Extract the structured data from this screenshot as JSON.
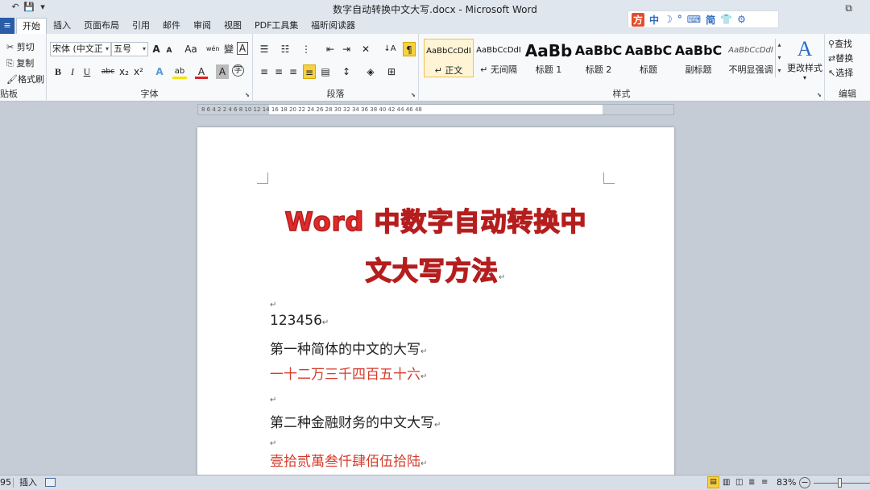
{
  "window": {
    "title": "数字自动转换中文大写.docx - Microsoft Word",
    "restore_symbol": "⧉"
  },
  "qat": {
    "save": "💾",
    "undo": "↶",
    "redo": "↷",
    "more": "▾"
  },
  "tabs": {
    "file": "≡",
    "items": [
      "开始",
      "插入",
      "页面布局",
      "引用",
      "邮件",
      "审阅",
      "视图",
      "PDF工具集",
      "福昕阅读器"
    ]
  },
  "topright_icons": [
    "方",
    "中",
    "☽",
    "°",
    "⌨",
    "简",
    "👕",
    "⚙"
  ],
  "clipboard": {
    "cut": "剪切",
    "copy": "复制",
    "painter": "格式刷",
    "label": "贴板"
  },
  "font": {
    "name": "宋体 (中文正",
    "size": "五号",
    "grow": "A",
    "shrink": "A",
    "case": "Aa",
    "phonetic": "wén",
    "encircle": "變",
    "border": "A",
    "bold": "B",
    "italic": "I",
    "underline": "U",
    "strike": "abc",
    "sub": "x₂",
    "sup": "x²",
    "effects": "A",
    "highlight": "ab",
    "color": "A",
    "shade": "A",
    "enclose": "字",
    "label": "字体"
  },
  "paragraph": {
    "label": "段落",
    "sort": "↓A",
    "show": "¶"
  },
  "styles": {
    "label": "样式",
    "items": [
      {
        "preview": "AaBbCcDdI",
        "name": "↵ 正文"
      },
      {
        "preview": "AaBbCcDdI",
        "name": "↵ 无间隔"
      },
      {
        "preview": "AaBb",
        "name": "标题 1"
      },
      {
        "preview": "AaBbC",
        "name": "标题 2"
      },
      {
        "preview": "AaBbC",
        "name": "标题"
      },
      {
        "preview": "AaBbC",
        "name": "副标题"
      },
      {
        "preview": "AaBbCcDdI",
        "name": "不明显强调"
      }
    ],
    "change": "更改样式",
    "change_icon": "A"
  },
  "editing": {
    "find": "查找",
    "replace": "替换",
    "select": "选择",
    "label": "编辑"
  },
  "ruler": "8  6  4  2     2  4  6  8  10  12  14  16  18  20  22  24  26  28  30  32  34  36  38     40  42  44  46  48",
  "document": {
    "title_line1": "Word 中数字自动转换中",
    "title_line2": "文大写方法",
    "para_mark": "↵",
    "lines": [
      {
        "text": "",
        "color": "black"
      },
      {
        "text": "123456",
        "color": "black"
      },
      {
        "text": "第一种简体的中文的大写",
        "color": "black"
      },
      {
        "text": "一十二万三千四百五十六",
        "color": "red"
      },
      {
        "text": "",
        "color": "black"
      },
      {
        "text": "第二种金融财务的中文大写",
        "color": "black"
      },
      {
        "text": "",
        "color": "black"
      },
      {
        "text": "壹拾贰萬叁仟肆佰伍拾陆",
        "color": "red"
      }
    ]
  },
  "status": {
    "words": "95",
    "mode": "插入",
    "zoom": "83%",
    "zoom_minus": "−"
  }
}
